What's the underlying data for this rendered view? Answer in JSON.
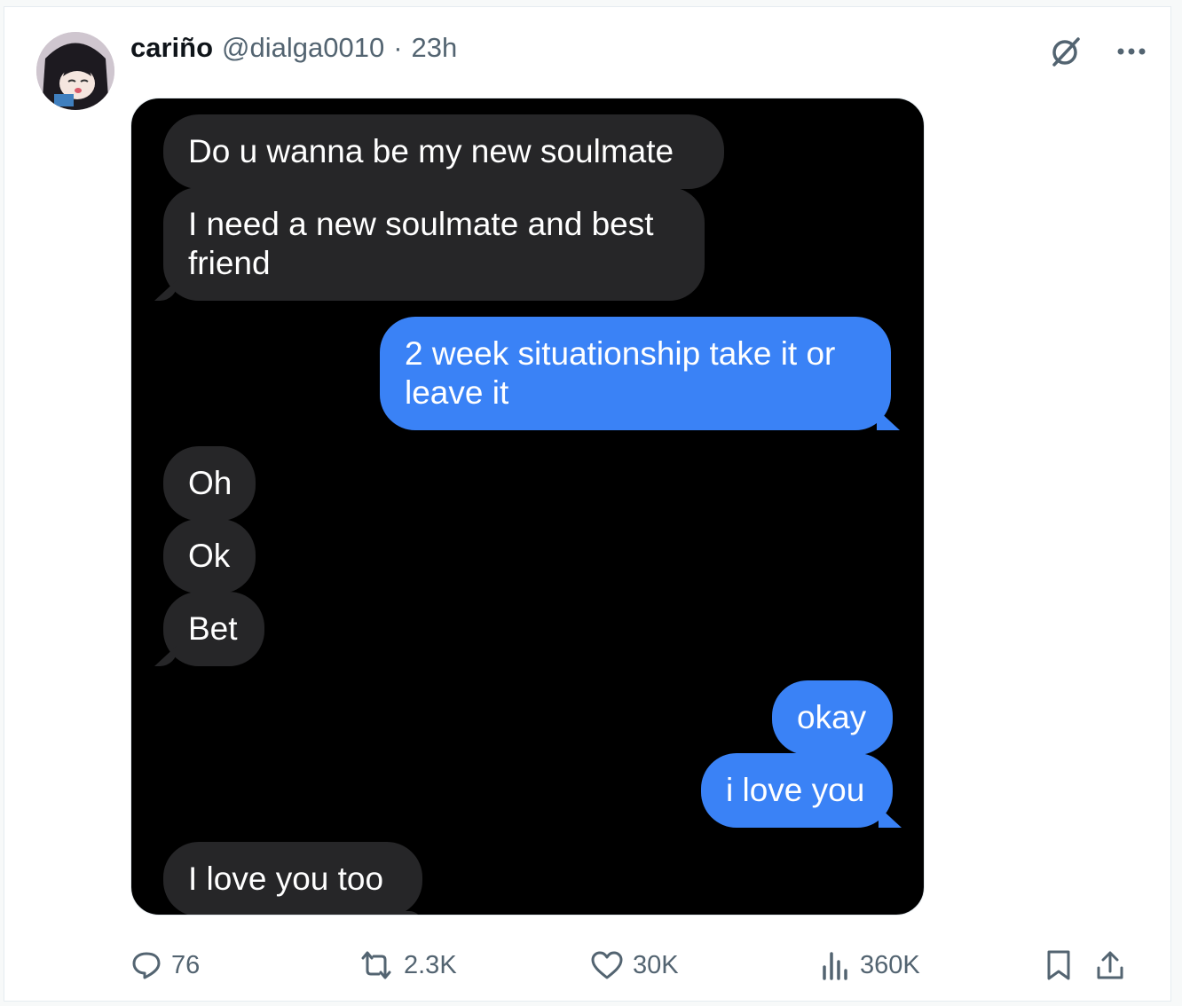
{
  "post": {
    "display_name": "cariño",
    "handle": "@dialga0010",
    "separator": "·",
    "time": "23h"
  },
  "messages": [
    {
      "side": "recv",
      "text": "Do u wanna be my new soulmate"
    },
    {
      "side": "recv",
      "text": "I need a new soulmate and best friend"
    },
    {
      "side": "sent",
      "text": "2 week situationship take it or leave it"
    },
    {
      "side": "recv",
      "text": "Oh"
    },
    {
      "side": "recv",
      "text": "Ok"
    },
    {
      "side": "recv",
      "text": "Bet"
    },
    {
      "side": "sent",
      "text": "okay"
    },
    {
      "side": "sent",
      "text": "i love you"
    },
    {
      "side": "recv",
      "text": "I love you too"
    }
  ],
  "actions": {
    "replies": "76",
    "reposts": "2.3K",
    "likes": "30K",
    "views": "360K"
  },
  "colors": {
    "sent_bubble": "#3a82f6",
    "received_bubble": "#262628",
    "muted_text": "#536471"
  },
  "icons": [
    "grok-icon",
    "more-icon",
    "reply-icon",
    "repost-icon",
    "like-icon",
    "views-icon",
    "bookmark-icon",
    "share-icon"
  ]
}
